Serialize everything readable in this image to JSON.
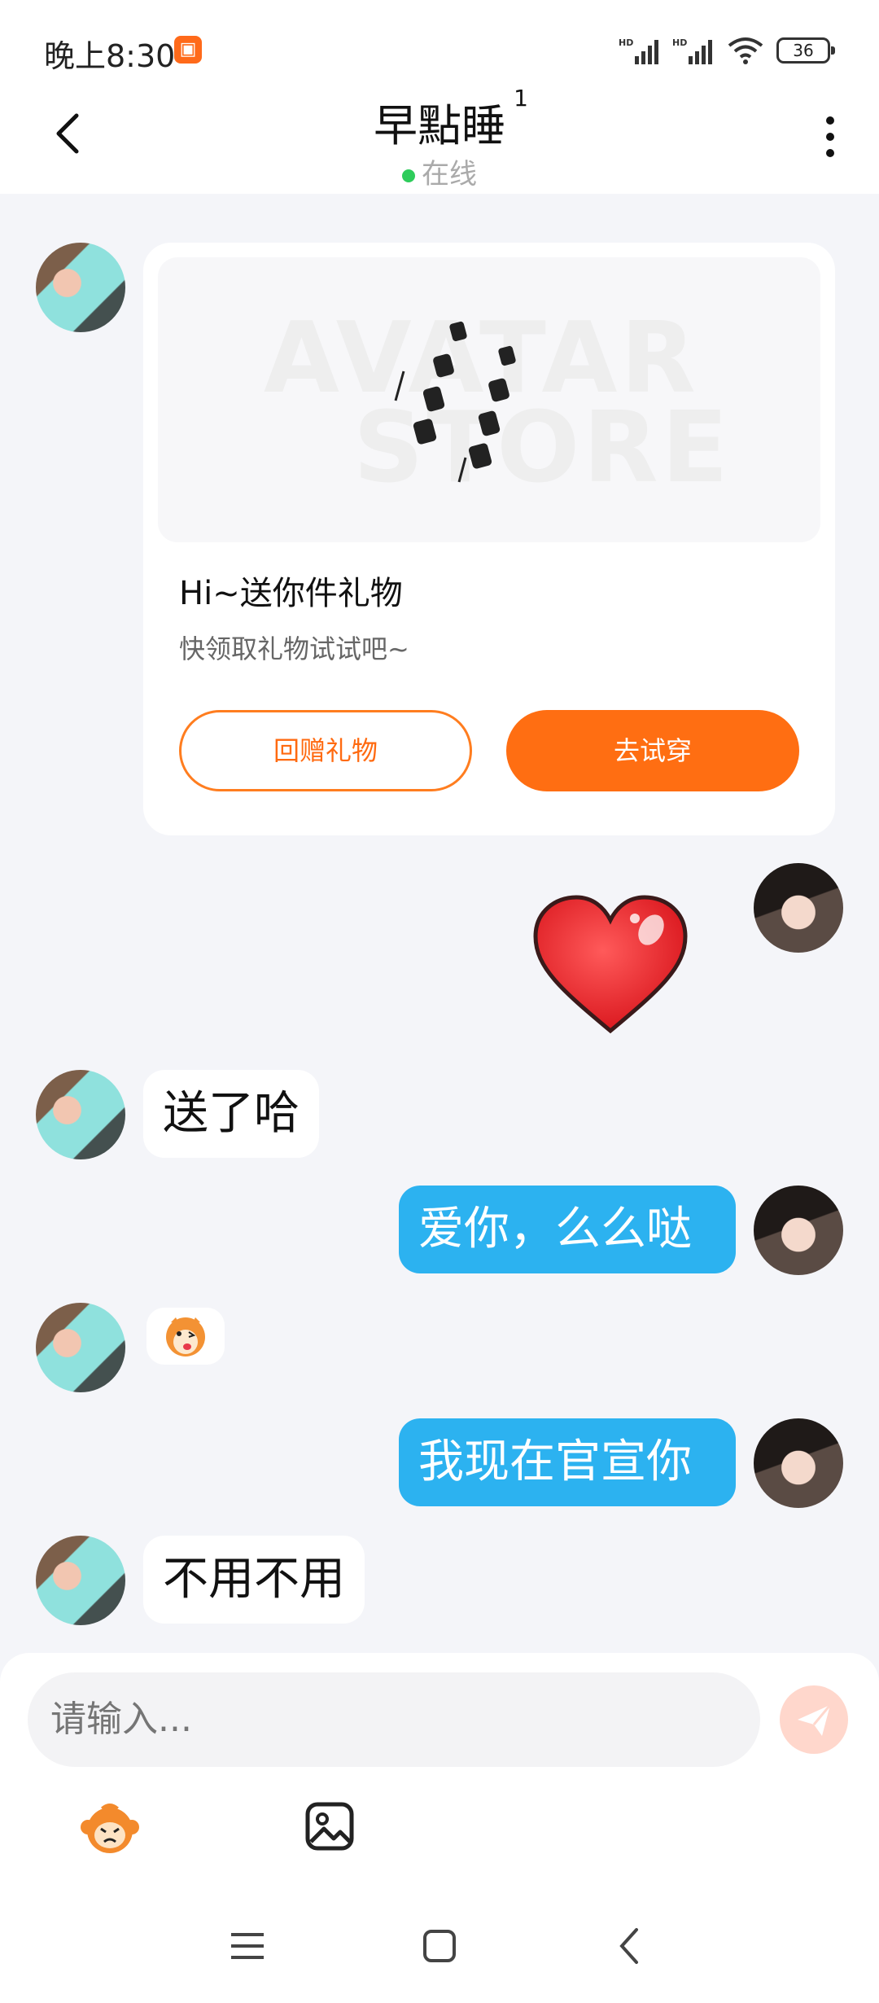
{
  "status_bar": {
    "time": "晚上8:30",
    "battery": "36",
    "signal1": "HD",
    "signal2": "HD"
  },
  "header": {
    "title": "早點睡",
    "unread": "1",
    "status": "在线"
  },
  "gift_card": {
    "title": "Hi~送你件礼物",
    "subtitle": "快领取礼物试试吧~",
    "watermark_line1": "AVATAR",
    "watermark_line2": "STORE",
    "return_label": "回赠礼物",
    "try_label": "去试穿"
  },
  "messages": [
    {
      "side": "right",
      "type": "sticker",
      "sticker": "heart-sticker"
    },
    {
      "side": "left",
      "type": "text",
      "text": "送了哈"
    },
    {
      "side": "right",
      "type": "text",
      "text": "爱你，么么哒"
    },
    {
      "side": "left",
      "type": "sticker",
      "sticker": "tiger-sticker"
    },
    {
      "side": "right",
      "type": "text",
      "text": "我现在官宣你"
    },
    {
      "side": "left",
      "type": "text",
      "text": "不用不用"
    }
  ],
  "input": {
    "placeholder": "请输入..."
  },
  "icons": {
    "back": "back-arrow-icon",
    "more": "more-vertical-icon",
    "send": "send-icon",
    "emoji": "monkey-emoji-icon",
    "image": "image-icon"
  },
  "colors": {
    "accent_orange": "#ff6e12",
    "bubble_blue": "#2cb2f0",
    "online_green": "#2ecc5b"
  }
}
